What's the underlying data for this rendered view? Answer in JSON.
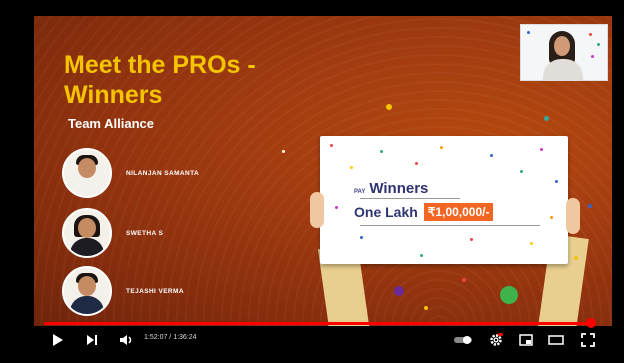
{
  "slide": {
    "title": "Meet the PROs - Winners",
    "subtitle": "Team Alliance",
    "members": [
      {
        "name": "NILANJAN SAMANTA"
      },
      {
        "name": "SWETHA S"
      },
      {
        "name": "TEJASHI VERMA"
      }
    ],
    "cheque": {
      "pay_label": "PAY",
      "payee": "Winners",
      "amount_words": "One Lakh",
      "amount_figure": "₹1,00,000/-"
    }
  },
  "player": {
    "time_display": "1:52:07 / 1:36:24",
    "progress_fraction": 1.0,
    "colors": {
      "progress": "#ff0000",
      "title": "#f5c400",
      "amount_box": "#f26522"
    },
    "icons": [
      "play-icon",
      "next-icon",
      "volume-icon",
      "autoplay-toggle-icon",
      "settings-icon",
      "miniplayer-icon",
      "theater-icon",
      "fullscreen-icon"
    ]
  }
}
